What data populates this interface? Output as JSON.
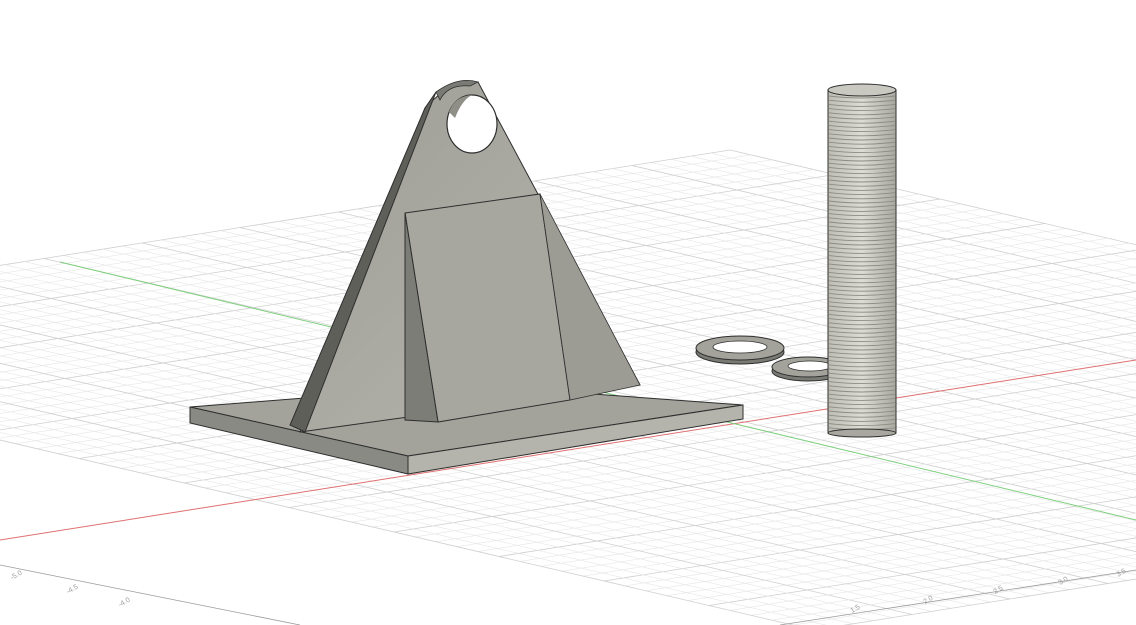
{
  "app": {
    "view": "3D viewport"
  },
  "colors": {
    "background": "#ffffff",
    "grid_minor": "#e6e6e6",
    "grid_major": "#cfcfcf",
    "axis_x": "#e07070",
    "axis_y": "#7fcf7f",
    "part_face": "#a9a9a1",
    "part_dark": "#6f6f6a",
    "part_edge": "#2e2e2e"
  },
  "scene": {
    "objects": [
      "bracket-base-plate",
      "triangular-gusset",
      "center-rib",
      "washer",
      "washer",
      "threaded-rod"
    ]
  },
  "rulers": {
    "left_ticks": [
      "-5.0",
      "-4.5",
      "-4.0"
    ],
    "bottom_ticks": [
      "1.5",
      "2.0",
      "2.5",
      "3.0",
      "3.5"
    ]
  }
}
